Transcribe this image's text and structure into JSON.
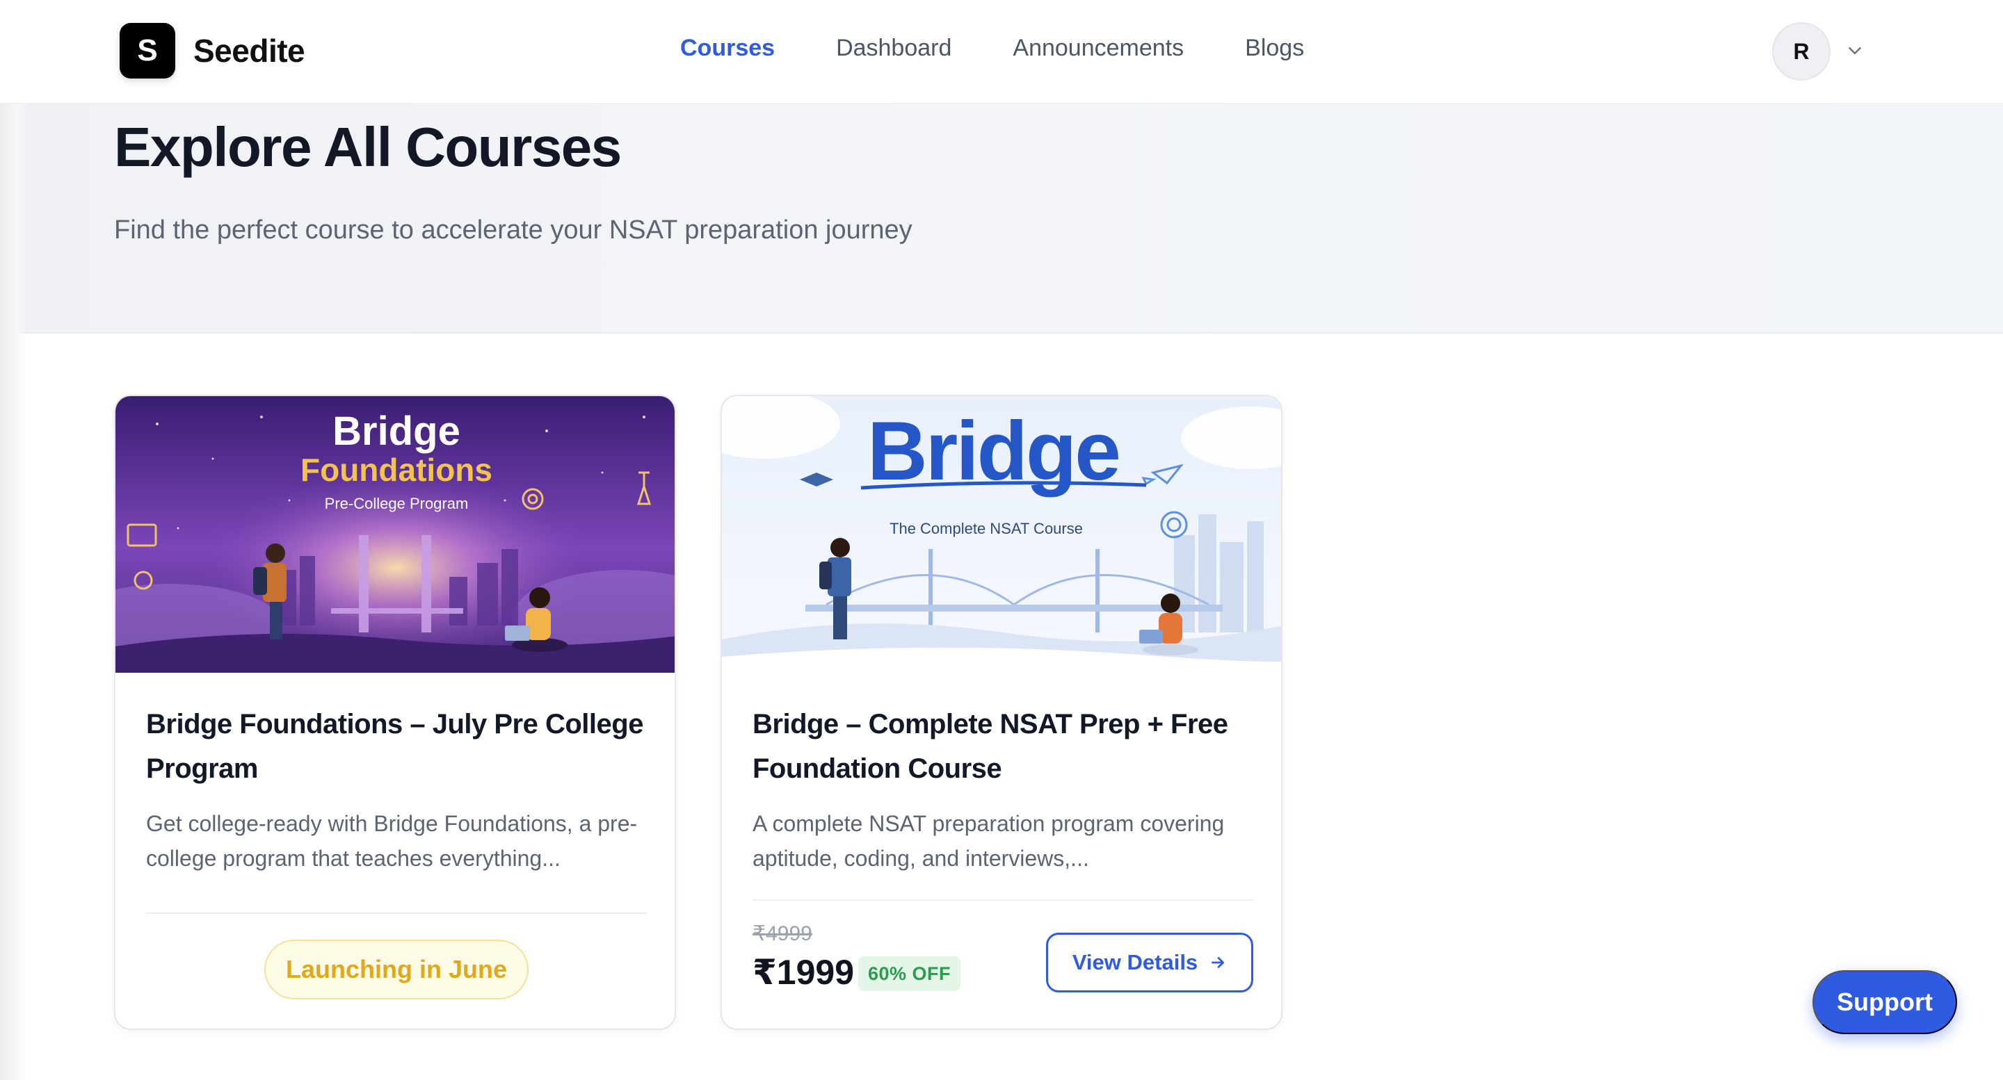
{
  "brand": {
    "logo_letter": "S",
    "name": "Seedite"
  },
  "nav": {
    "links": [
      {
        "label": "Courses",
        "active": true
      },
      {
        "label": "Dashboard",
        "active": false
      },
      {
        "label": "Announcements",
        "active": false
      },
      {
        "label": "Blogs",
        "active": false
      }
    ]
  },
  "user": {
    "avatar_initial": "R"
  },
  "hero": {
    "title": "Explore All Courses",
    "subtitle": "Find the perfect course to accelerate your NSAT preparation journey"
  },
  "courses": [
    {
      "image": {
        "title": "Bridge",
        "subtitle": "Foundations",
        "tagline": "Pre-College Program"
      },
      "title": "Bridge Foundations – July Pre College Program",
      "description": "Get college-ready with Bridge Foundations, a pre-college program that teaches everything...",
      "status_badge": "Launching in June"
    },
    {
      "image": {
        "title": "Bridge",
        "tagline": "The Complete NSAT Course"
      },
      "title": "Bridge – Complete NSAT Prep + Free Foundation Course",
      "description": "A complete NSAT preparation program covering aptitude, coding, and interviews,...",
      "old_price": "₹4999",
      "price": "₹1999",
      "discount": "60% OFF",
      "cta": "View Details"
    }
  ],
  "support": {
    "label": "Support"
  },
  "colors": {
    "accent": "#2f5be0",
    "launch_text": "#e0a81a",
    "discount_text": "#2e9a4e"
  }
}
